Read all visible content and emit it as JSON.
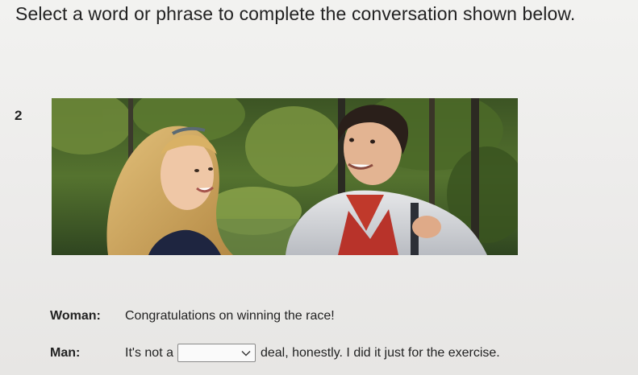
{
  "instruction": "Select a word or phrase to complete the conversation shown below.",
  "question_number": "2",
  "photo": {
    "icon": "conversation-photo"
  },
  "dialogue": {
    "woman": {
      "speaker": "Woman:",
      "text": "Congratulations on winning the race!"
    },
    "man": {
      "speaker": "Man:",
      "before_blank": "It's not a",
      "selected_value": "",
      "after_blank": "deal, honestly. I did it just for the exercise."
    }
  }
}
